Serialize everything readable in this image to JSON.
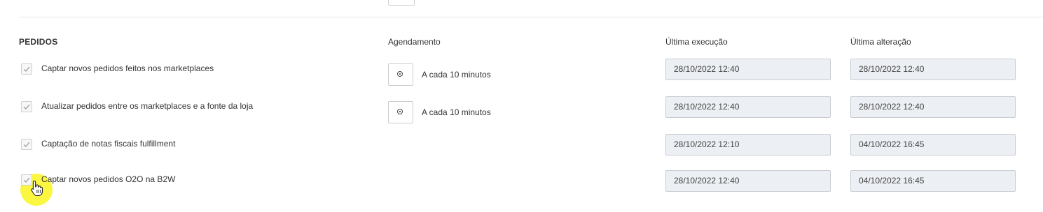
{
  "section": {
    "title": "PEDIDOS"
  },
  "columns": {
    "schedule": "Agendamento",
    "last_execution": "Última execução",
    "last_change": "Última alteração"
  },
  "rows": [
    {
      "label": "Captar novos pedidos feitos nos marketplaces",
      "checked": true,
      "schedule": "A cada 10 minutos",
      "last_execution": "28/10/2022 12:40",
      "last_change": "28/10/2022 12:40"
    },
    {
      "label": "Atualizar pedidos entre os marketplaces e a fonte da loja",
      "checked": true,
      "schedule": "A cada 10 minutos",
      "last_execution": "28/10/2022 12:40",
      "last_change": "28/10/2022 12:40"
    },
    {
      "label": "Captação de notas fiscais fulfillment",
      "checked": true,
      "schedule": "",
      "last_execution": "28/10/2022 12:10",
      "last_change": "04/10/2022 16:45"
    },
    {
      "label": "Captar novos pedidos O2O na B2W",
      "checked": true,
      "schedule": "",
      "last_execution": "28/10/2022 12:40",
      "last_change": "04/10/2022 16:45"
    }
  ],
  "icons": {
    "checkbox": "check-icon",
    "schedule_button": "clock-icon",
    "cursor": "hand-pointer-icon"
  },
  "colors": {
    "field_background": "#eceff3",
    "cursor_highlight": "#faf51e"
  }
}
